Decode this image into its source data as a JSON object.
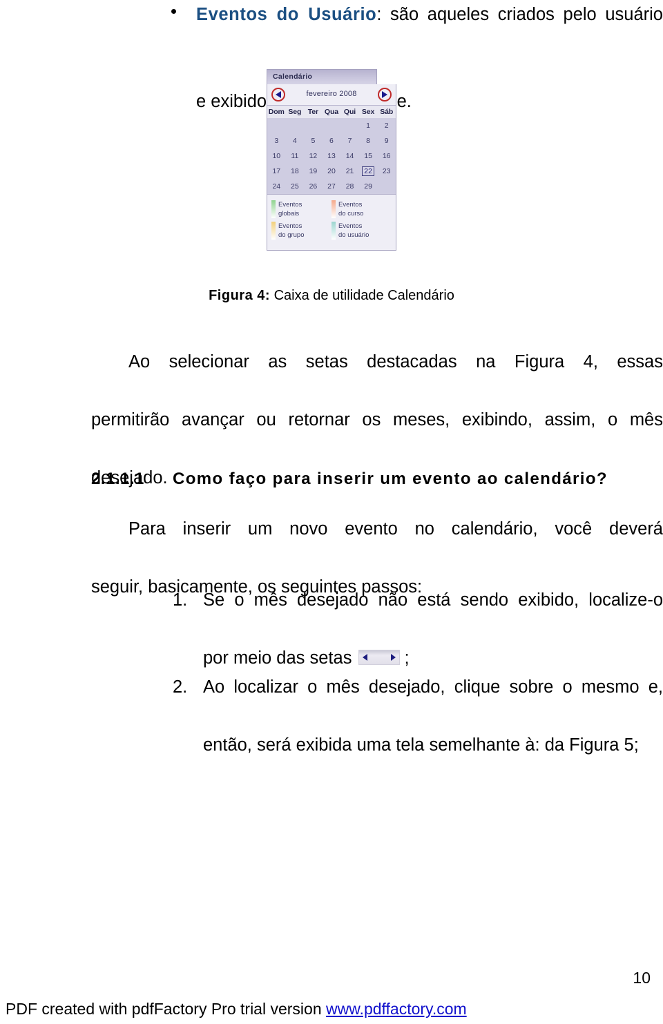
{
  "bullet": {
    "term": "Eventos do Usuário",
    "rest_line1": ": são aqueles criados pelo usuário",
    "line2": "e exibidos apenas para ele."
  },
  "calendar_widget": {
    "title": "Calendário",
    "month_label": "fevereiro 2008",
    "prev_icon": "left-arrow-icon",
    "next_icon": "right-arrow-icon",
    "weekday_headers": [
      "Dom",
      "Seg",
      "Ter",
      "Qua",
      "Qui",
      "Sex",
      "Sáb"
    ],
    "weeks": [
      [
        "",
        "",
        "",
        "",
        "",
        "1",
        "2"
      ],
      [
        "3",
        "4",
        "5",
        "6",
        "7",
        "8",
        "9"
      ],
      [
        "10",
        "11",
        "12",
        "13",
        "14",
        "15",
        "16"
      ],
      [
        "17",
        "18",
        "19",
        "20",
        "21",
        "22",
        "23"
      ],
      [
        "24",
        "25",
        "26",
        "27",
        "28",
        "29",
        ""
      ]
    ],
    "selected_day": "22",
    "legend": [
      {
        "label_line1": "Eventos",
        "label_line2": "globais",
        "color": "#8fd38f"
      },
      {
        "label_line1": "Eventos",
        "label_line2": "do curso",
        "color": "#f5a98c"
      },
      {
        "label_line1": "Eventos",
        "label_line2": "do grupo",
        "color": "#f2cf7a"
      },
      {
        "label_line1": "Eventos",
        "label_line2": "do usuário",
        "color": "#9ad5cf"
      }
    ]
  },
  "figure_caption": {
    "label": "Figura 4:",
    "text": " Caixa de utilidade Calendário"
  },
  "paragraph_figura": {
    "line1": "Ao selecionar as setas destacadas na Figura 4, essas",
    "line2": "permitirão avançar ou retornar os meses, exibindo, assim, o mês",
    "line3": "desejado."
  },
  "heading": {
    "number": "2.1.1.1",
    "title": "Como faço para inserir um evento ao calendário?"
  },
  "paragraph_passos": {
    "line1": "Para inserir um novo evento no calendário, você deverá",
    "line2": "seguir, basicamente, os seguintes passos:"
  },
  "steps": [
    {
      "number": "1.",
      "line1": "Se o mês desejado não está sendo exibido, localize-o",
      "line2_before": "por meio das setas",
      "inline_icon": "month-arrows-icon",
      "line2_after": ";"
    },
    {
      "number": "2.",
      "line1": "Ao localizar o mês desejado, clique sobre o mesmo e,",
      "line2_before": "então, será exibida uma tela semelhante à: da Figura 5;",
      "inline_icon": "",
      "line2_after": ""
    }
  ],
  "footer": {
    "page_number": "10",
    "watermark_text": "PDF created with pdfFactory Pro trial version ",
    "watermark_link": "www.pdffactory.com",
    "link_color": "#1111cc"
  }
}
